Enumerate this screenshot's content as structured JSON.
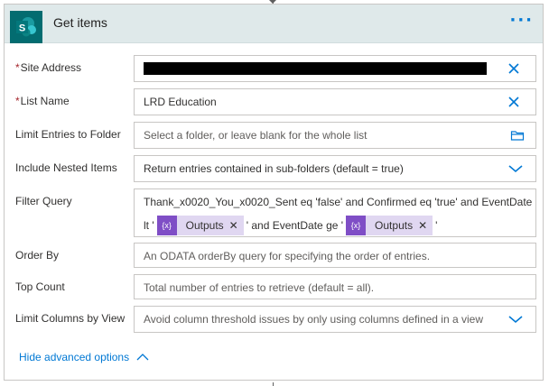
{
  "header": {
    "title": "Get items",
    "more": "···"
  },
  "fields": {
    "site_address": {
      "label": "Site Address",
      "required": "*"
    },
    "list_name": {
      "label": "List Name",
      "required": "*",
      "value": "LRD Education"
    },
    "limit_folder": {
      "label": "Limit Entries to Folder",
      "placeholder": "Select a folder, or leave blank for the whole list"
    },
    "nested": {
      "label": "Include Nested Items",
      "value": "Return entries contained in sub-folders (default = true)"
    },
    "filter": {
      "label": "Filter Query",
      "line1": "Thank_x0020_You_x0020_Sent eq 'false' and Confirmed eq 'true' and EventDate",
      "line2_a": "lt '",
      "token1": "Outputs",
      "line2_b": "' and EventDate ge '",
      "token2": "Outputs",
      "line2_c": "'",
      "token_icon": "{x}"
    },
    "order_by": {
      "label": "Order By",
      "placeholder": "An ODATA orderBy query for specifying the order of entries."
    },
    "top_count": {
      "label": "Top Count",
      "placeholder": "Total number of entries to retrieve (default = all)."
    },
    "limit_columns": {
      "label": "Limit Columns by View",
      "placeholder": "Avoid column threshold issues by only using columns defined in a view"
    }
  },
  "footer": {
    "hide_advanced": "Hide advanced options"
  },
  "colors": {
    "accent": "#0078d4",
    "sharepoint": "#036c70",
    "token": "#7f4ec6",
    "header_bg": "#dfe9ea"
  }
}
